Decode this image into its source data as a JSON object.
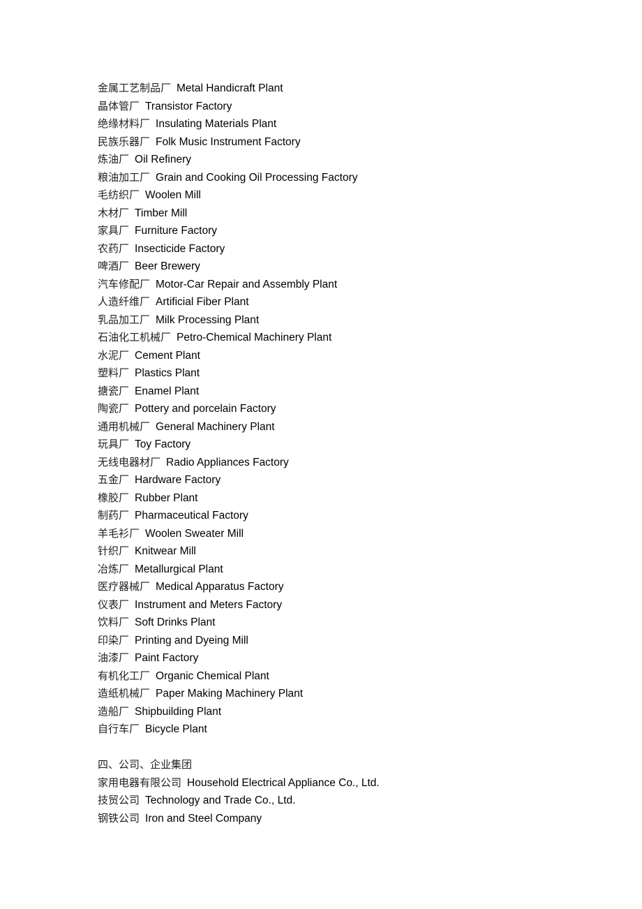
{
  "factories": [
    {
      "zh": "金属工艺制品厂",
      "en": "Metal Handicraft Plant"
    },
    {
      "zh": "晶体管厂",
      "en": "Transistor Factory"
    },
    {
      "zh": "绝缘材料厂",
      "en": "Insulating Materials Plant"
    },
    {
      "zh": "民族乐器厂",
      "en": "Folk Music Instrument Factory"
    },
    {
      "zh": "炼油厂",
      "en": "Oil Refinery"
    },
    {
      "zh": "粮油加工厂",
      "en": "Grain and Cooking Oil Processing Factory"
    },
    {
      "zh": "毛纺织厂",
      "en": "Woolen Mill"
    },
    {
      "zh": "木材厂",
      "en": "Timber Mill"
    },
    {
      "zh": "家具厂",
      "en": "Furniture Factory"
    },
    {
      "zh": "农药厂",
      "en": "Insecticide Factory"
    },
    {
      "zh": "啤酒厂",
      "en": "Beer Brewery"
    },
    {
      "zh": "汽车修配厂",
      "en": "Motor-Car Repair and Assembly Plant"
    },
    {
      "zh": "人造纤维厂",
      "en": "Artificial Fiber Plant"
    },
    {
      "zh": "乳品加工厂",
      "en": "Milk Processing Plant"
    },
    {
      "zh": "石油化工机械厂",
      "en": "Petro-Chemical Machinery Plant"
    },
    {
      "zh": "水泥厂",
      "en": "Cement Plant"
    },
    {
      "zh": "塑料厂",
      "en": "Plastics Plant"
    },
    {
      "zh": "搪瓷厂",
      "en": "Enamel Plant"
    },
    {
      "zh": "陶瓷厂",
      "en": "Pottery and porcelain Factory"
    },
    {
      "zh": "通用机械厂",
      "en": "General Machinery Plant"
    },
    {
      "zh": "玩具厂",
      "en": "Toy Factory"
    },
    {
      "zh": "无线电器材厂",
      "en": "Radio Appliances Factory"
    },
    {
      "zh": "五金厂",
      "en": "Hardware Factory"
    },
    {
      "zh": "橡胶厂",
      "en": "Rubber Plant"
    },
    {
      "zh": "制药厂",
      "en": "Pharmaceutical Factory"
    },
    {
      "zh": "羊毛衫厂",
      "en": "Woolen Sweater Mill"
    },
    {
      "zh": "针织厂",
      "en": "Knitwear Mill"
    },
    {
      "zh": "冶炼厂",
      "en": "Metallurgical Plant"
    },
    {
      "zh": "医疗器械厂",
      "en": "Medical Apparatus Factory"
    },
    {
      "zh": "仪表厂",
      "en": "Instrument and Meters Factory"
    },
    {
      "zh": "饮料厂",
      "en": "Soft Drinks Plant"
    },
    {
      "zh": "印染厂",
      "en": "Printing and Dyeing Mill"
    },
    {
      "zh": "油漆厂",
      "en": "Paint Factory"
    },
    {
      "zh": "有机化工厂",
      "en": "Organic Chemical Plant"
    },
    {
      "zh": "造纸机械厂",
      "en": "Paper Making Machinery Plant"
    },
    {
      "zh": "造船厂",
      "en": "Shipbuilding Plant"
    },
    {
      "zh": "自行车厂",
      "en": "Bicycle Plant"
    }
  ],
  "section4": {
    "heading": "四、公司、企业集团",
    "items": [
      {
        "zh": "家用电器有限公司",
        "en": "Household Electrical Appliance Co., Ltd."
      },
      {
        "zh": "技贸公司",
        "en": "Technology and Trade Co., Ltd."
      },
      {
        "zh": "钢铁公司",
        "en": "Iron and Steel Company"
      }
    ]
  }
}
